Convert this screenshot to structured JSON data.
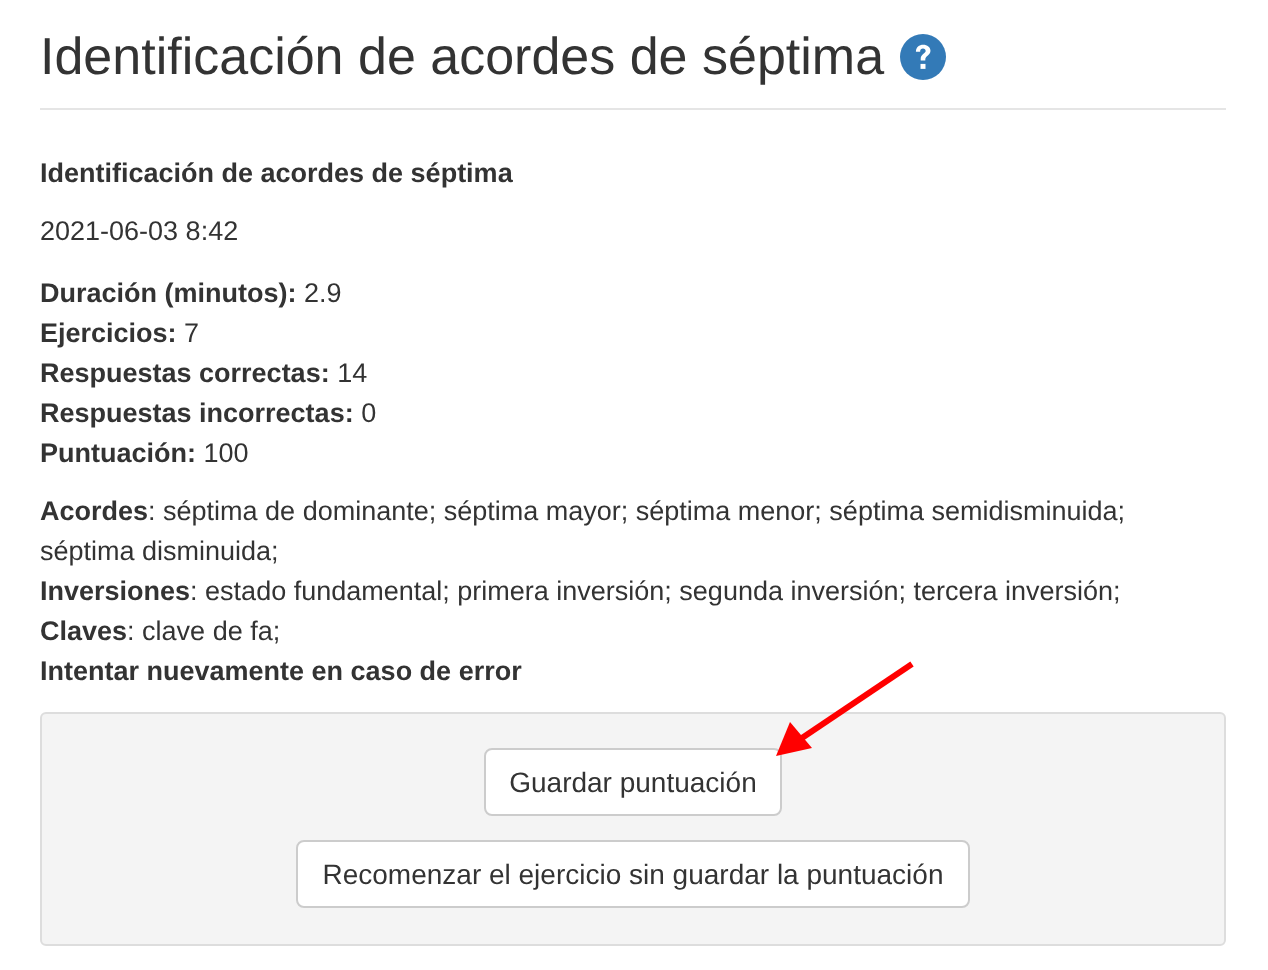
{
  "page_title": "Identificación de acordes de séptima",
  "help_icon": {
    "kind": "question"
  },
  "result": {
    "title": "Identificación de acordes de séptima",
    "date": "2021-06-03 8:42",
    "stats": [
      "**Duración (minutos):** 2.9",
      "**Ejercicios:** 7",
      "**Respuestas correctas:** 14",
      "**Respuestas incorrectas:** 0",
      "**Puntuación:** 100"
    ],
    "settings": [
      "**Acordes**: séptima de dominante; séptima mayor; séptima menor; séptima semidisminuida; séptima disminuida;",
      "**Inversiones**: estado fundamental; primera inversión; segunda inversión; tercera inversión;",
      "**Claves**: clave de fa;",
      "**Intentar nuevamente en caso de error**"
    ]
  },
  "buttons": [
    "Guardar puntuación",
    "Recomenzar el ejercicio sin guardar la puntuación"
  ]
}
